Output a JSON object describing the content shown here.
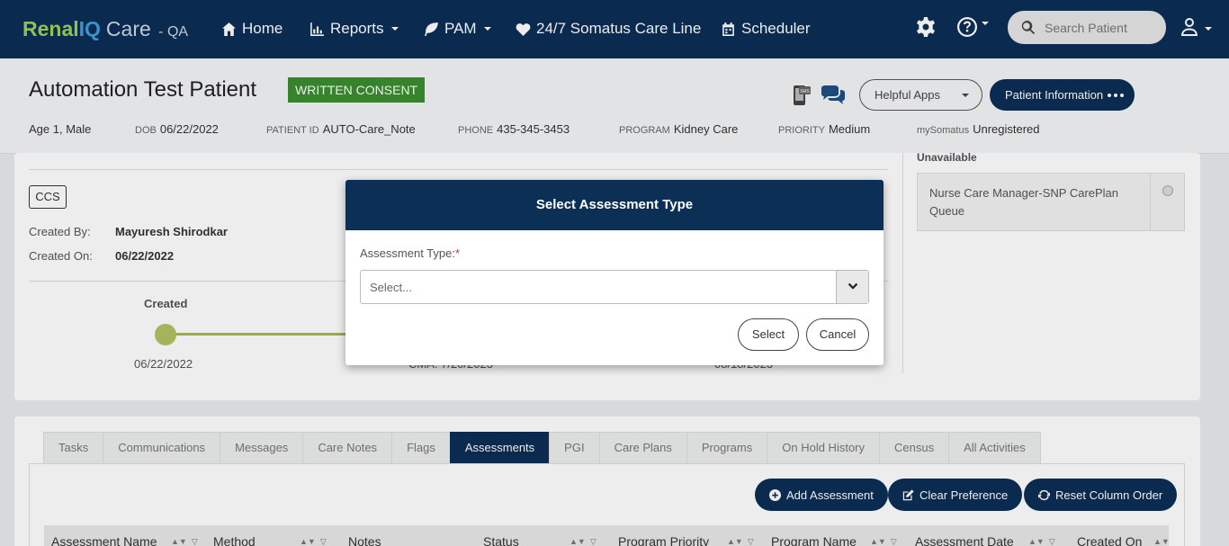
{
  "navbar": {
    "brand": {
      "part1": "Renal",
      "part2": "IQ",
      "part3": "Care",
      "env": "- QA"
    },
    "items": [
      {
        "label": "Home",
        "icon": "home-icon"
      },
      {
        "label": "Reports",
        "icon": "bar-chart-icon"
      },
      {
        "label": "PAM",
        "icon": "leaf-icon"
      },
      {
        "label": "24/7 Somatus Care Line",
        "icon": "heartbeat-icon"
      },
      {
        "label": "Scheduler",
        "icon": "calendar-icon"
      }
    ],
    "search_placeholder": "Search Patient"
  },
  "patient": {
    "name": "Automation Test Patient",
    "consent": "WRITTEN CONSENT",
    "age_sex": "Age 1, Male",
    "dob_label": "DOB",
    "dob": "06/22/2022",
    "id_label": "PATIENT ID",
    "id": "AUTO-Care_Note",
    "phone_label": "PHONE",
    "phone": "435-345-3453",
    "program_label": "PROGRAM",
    "program": "Kidney Care",
    "priority_label": "PRIORITY",
    "priority": "Medium",
    "mysomatus_label": "mySomatus",
    "mysomatus": "Unregistered",
    "helpful_apps": "Helpful Apps",
    "patient_info": "Patient Information"
  },
  "careplan": {
    "tag": "CCS",
    "created_by_label": "Created By:",
    "created_by": "Mayuresh Shirodkar",
    "created_on_label": "Created On:",
    "created_on": "06/22/2022",
    "timeline_label": "Created",
    "timeline_date": "06/22/2022",
    "timeline_mid": "CMA: 7/20/2023",
    "timeline_right": "08/18/2023",
    "unavailable": "Unavailable",
    "queue_text": "Nurse Care Manager-SNP CarePlan Queue"
  },
  "tabs": [
    "Tasks",
    "Communications",
    "Messages",
    "Care Notes",
    "Flags",
    "Assessments",
    "PGI",
    "Care Plans",
    "Programs",
    "On Hold History",
    "Census",
    "All Activities"
  ],
  "active_tab": "Assessments",
  "actions": {
    "add": "Add Assessment",
    "clear": "Clear Preference",
    "reset": "Reset Column Order"
  },
  "columns": [
    "Assessment Name",
    "Method",
    "Notes",
    "Status",
    "Program Priority",
    "Program Name",
    "Assessment Date",
    "Created On"
  ],
  "modal": {
    "title": "Select Assessment Type",
    "field_label": "Assessment Type:",
    "required_mark": "*",
    "placeholder": "Select...",
    "select_btn": "Select",
    "cancel_btn": "Cancel"
  }
}
